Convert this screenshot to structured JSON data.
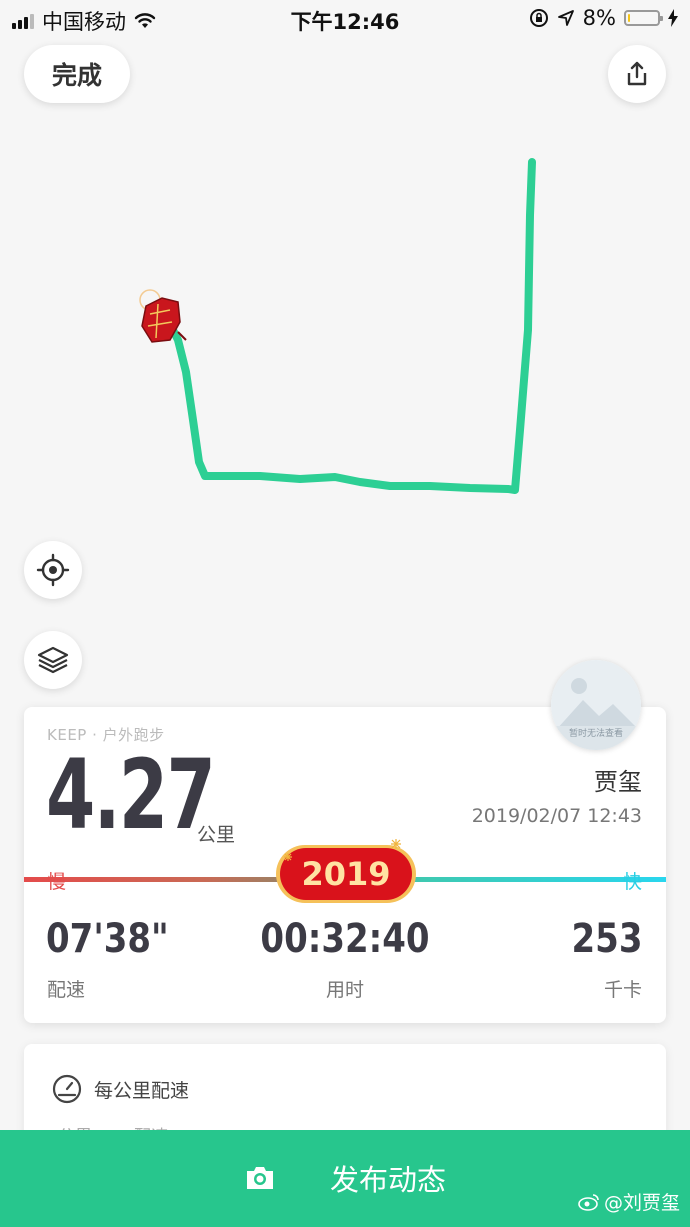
{
  "status_bar": {
    "carrier": "中国移动",
    "time": "下午12:46",
    "battery_percent": "8%",
    "battery_level": 0.08,
    "icons": [
      "signal-icon",
      "wifi-icon",
      "orientation-lock-icon",
      "location-arrow-icon",
      "battery-icon",
      "charging-bolt-icon"
    ]
  },
  "header": {
    "done_label": "完成",
    "share_icon": "share-icon"
  },
  "map": {
    "route_color": "#2dcf94",
    "controls": [
      "locate-icon",
      "layers-icon"
    ]
  },
  "summary": {
    "tag": "KEEP · 户外跑步",
    "distance": "4.27",
    "distance_unit": "公里",
    "user_name": "贾玺",
    "datetime": "2019/02/07 12:43",
    "avatar_caption": "暂时无法查看",
    "slow_label": "慢",
    "fast_label": "快",
    "badge_text": "2019",
    "stats": [
      {
        "value": "07'38\"",
        "label": "配速"
      },
      {
        "value": "00:32:40",
        "label": "用时"
      },
      {
        "value": "253",
        "label": "千卡"
      }
    ]
  },
  "pace_section": {
    "title": "每公里配速",
    "col1": "公里",
    "col2": "配速"
  },
  "bottom": {
    "publish_label": "发布动态",
    "camera_icon": "camera-icon"
  },
  "watermark": {
    "text": "@刘贾玺"
  },
  "colors": {
    "accent": "#27c68d",
    "slow": "#e44b4b",
    "fast": "#29cfe4"
  }
}
